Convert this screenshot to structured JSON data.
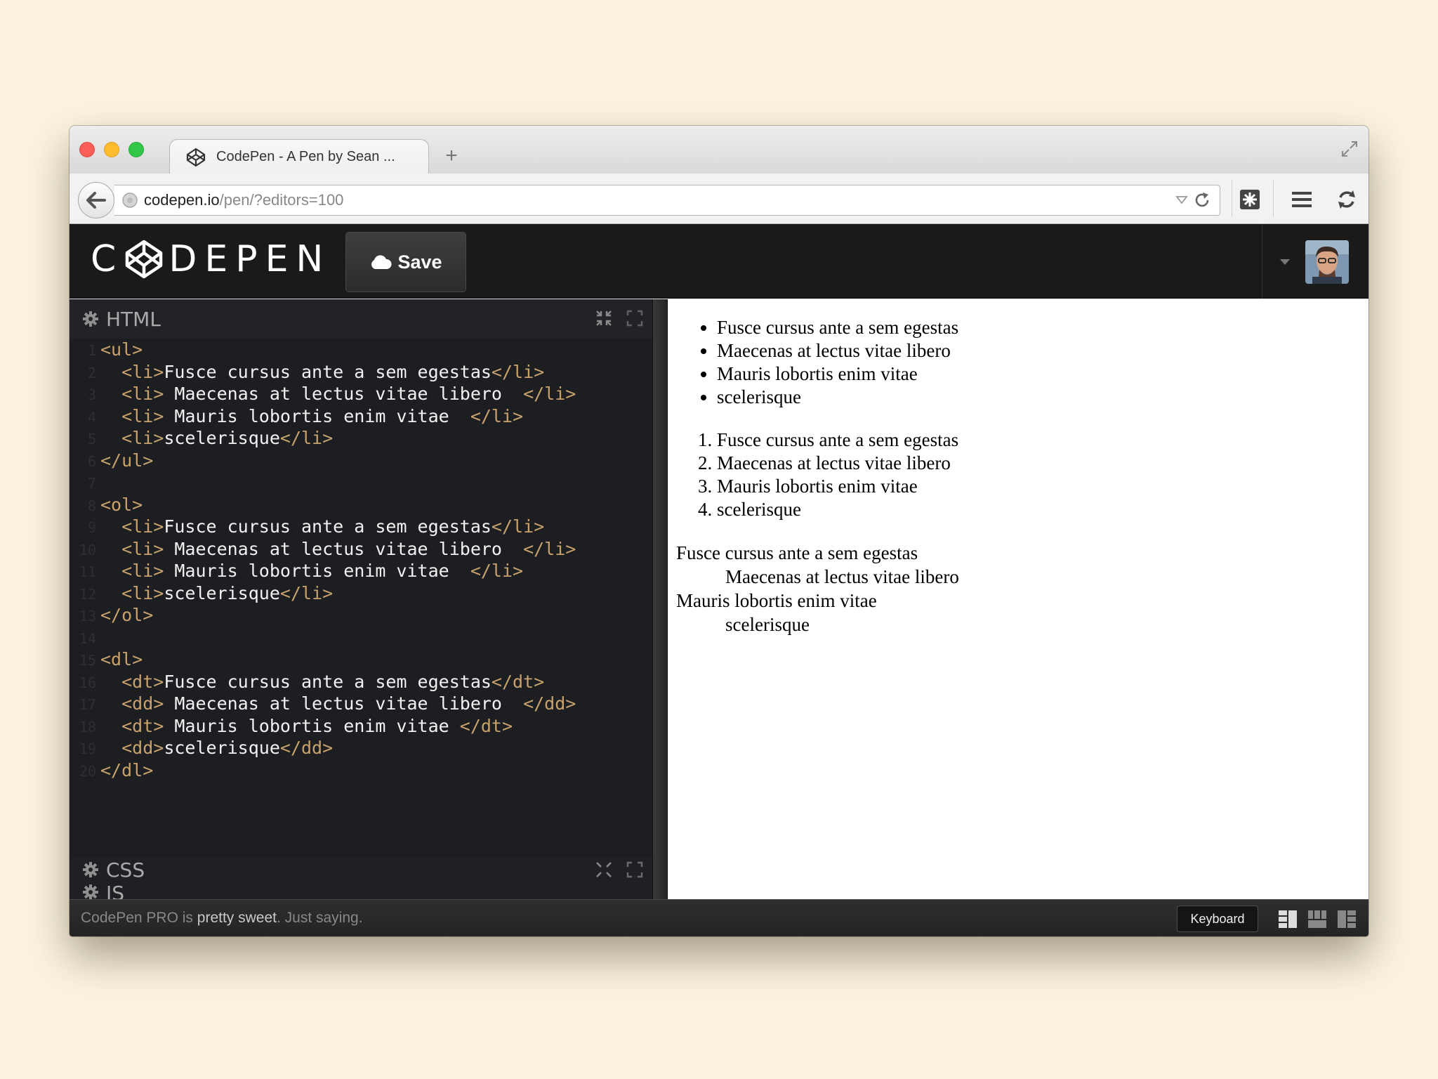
{
  "browser": {
    "tab_title": "CodePen - A Pen by Sean ...",
    "new_tab_label": "+",
    "url_host": "codepen.io",
    "url_path": "/pen/?editors=100"
  },
  "header": {
    "logo_text": "DEPEN",
    "logo_c": "C",
    "save_label": "Save"
  },
  "editor": {
    "html_title": "HTML",
    "css_title": "CSS",
    "js_title": "JS",
    "lines": [
      {
        "n": "1",
        "parts": [
          {
            "t": "tag",
            "v": "<ul>"
          }
        ]
      },
      {
        "n": "2",
        "parts": [
          {
            "t": "sp",
            "v": "  "
          },
          {
            "t": "tag",
            "v": "<li>"
          },
          {
            "t": "txt",
            "v": "Fusce cursus ante a sem egestas"
          },
          {
            "t": "tag",
            "v": "</li>"
          }
        ]
      },
      {
        "n": "3",
        "parts": [
          {
            "t": "sp",
            "v": "  "
          },
          {
            "t": "tag",
            "v": "<li>"
          },
          {
            "t": "txt",
            "v": " Maecenas at lectus vitae libero  "
          },
          {
            "t": "tag",
            "v": "</li>"
          }
        ]
      },
      {
        "n": "4",
        "parts": [
          {
            "t": "sp",
            "v": "  "
          },
          {
            "t": "tag",
            "v": "<li>"
          },
          {
            "t": "txt",
            "v": " Mauris lobortis enim vitae  "
          },
          {
            "t": "tag",
            "v": "</li>"
          }
        ]
      },
      {
        "n": "5",
        "parts": [
          {
            "t": "sp",
            "v": "  "
          },
          {
            "t": "tag",
            "v": "<li>"
          },
          {
            "t": "txt",
            "v": "scelerisque"
          },
          {
            "t": "tag",
            "v": "</li>"
          }
        ]
      },
      {
        "n": "6",
        "parts": [
          {
            "t": "tag",
            "v": "</ul>"
          }
        ]
      },
      {
        "n": "7",
        "parts": []
      },
      {
        "n": "8",
        "parts": [
          {
            "t": "tag",
            "v": "<ol>"
          }
        ]
      },
      {
        "n": "9",
        "parts": [
          {
            "t": "sp",
            "v": "  "
          },
          {
            "t": "tag",
            "v": "<li>"
          },
          {
            "t": "txt",
            "v": "Fusce cursus ante a sem egestas"
          },
          {
            "t": "tag",
            "v": "</li>"
          }
        ]
      },
      {
        "n": "10",
        "parts": [
          {
            "t": "sp",
            "v": "  "
          },
          {
            "t": "tag",
            "v": "<li>"
          },
          {
            "t": "txt",
            "v": " Maecenas at lectus vitae libero  "
          },
          {
            "t": "tag",
            "v": "</li>"
          }
        ]
      },
      {
        "n": "11",
        "parts": [
          {
            "t": "sp",
            "v": "  "
          },
          {
            "t": "tag",
            "v": "<li>"
          },
          {
            "t": "txt",
            "v": " Mauris lobortis enim vitae  "
          },
          {
            "t": "tag",
            "v": "</li>"
          }
        ]
      },
      {
        "n": "12",
        "parts": [
          {
            "t": "sp",
            "v": "  "
          },
          {
            "t": "tag",
            "v": "<li>"
          },
          {
            "t": "txt",
            "v": "scelerisque"
          },
          {
            "t": "tag",
            "v": "</li>"
          }
        ]
      },
      {
        "n": "13",
        "parts": [
          {
            "t": "tag",
            "v": "</ol>"
          }
        ]
      },
      {
        "n": "14",
        "parts": []
      },
      {
        "n": "15",
        "parts": [
          {
            "t": "tag",
            "v": "<dl>"
          }
        ]
      },
      {
        "n": "16",
        "parts": [
          {
            "t": "sp",
            "v": "  "
          },
          {
            "t": "tag",
            "v": "<dt>"
          },
          {
            "t": "txt",
            "v": "Fusce cursus ante a sem egestas"
          },
          {
            "t": "tag",
            "v": "</dt>"
          }
        ]
      },
      {
        "n": "17",
        "parts": [
          {
            "t": "sp",
            "v": "  "
          },
          {
            "t": "tag",
            "v": "<dd>"
          },
          {
            "t": "txt",
            "v": " Maecenas at lectus vitae libero  "
          },
          {
            "t": "tag",
            "v": "</dd>"
          }
        ]
      },
      {
        "n": "18",
        "parts": [
          {
            "t": "sp",
            "v": "  "
          },
          {
            "t": "tag",
            "v": "<dt>"
          },
          {
            "t": "txt",
            "v": " Mauris lobortis enim vitae "
          },
          {
            "t": "tag",
            "v": "</dt>"
          }
        ]
      },
      {
        "n": "19",
        "parts": [
          {
            "t": "sp",
            "v": "  "
          },
          {
            "t": "tag",
            "v": "<dd>"
          },
          {
            "t": "txt",
            "v": "scelerisque"
          },
          {
            "t": "tag",
            "v": "</dd>"
          }
        ]
      },
      {
        "n": "20",
        "parts": [
          {
            "t": "tag",
            "v": "</dl>"
          }
        ]
      }
    ]
  },
  "preview": {
    "ul_items": [
      "Fusce cursus ante a sem egestas",
      "Maecenas at lectus vitae libero",
      "Mauris lobortis enim vitae",
      "scelerisque"
    ],
    "ol_items": [
      "Fusce cursus ante a sem egestas",
      "Maecenas at lectus vitae libero",
      "Mauris lobortis enim vitae",
      "scelerisque"
    ],
    "dl_items": [
      {
        "type": "dt",
        "text": "Fusce cursus ante a sem egestas"
      },
      {
        "type": "dd",
        "text": "Maecenas at lectus vitae libero"
      },
      {
        "type": "dt",
        "text": "Mauris lobortis enim vitae"
      },
      {
        "type": "dd",
        "text": "scelerisque"
      }
    ]
  },
  "footer": {
    "msg_pre": "CodePen PRO",
    "msg_mid": " is ",
    "msg_strong": "pretty sweet",
    "msg_post": ". Just saying.",
    "keyboard_label": "Keyboard"
  },
  "colors": {
    "tag": "#c8a26d",
    "code_text": "#f2f2f2",
    "editor_bg": "#1d1e22",
    "page_bg": "#fbf3e0"
  }
}
